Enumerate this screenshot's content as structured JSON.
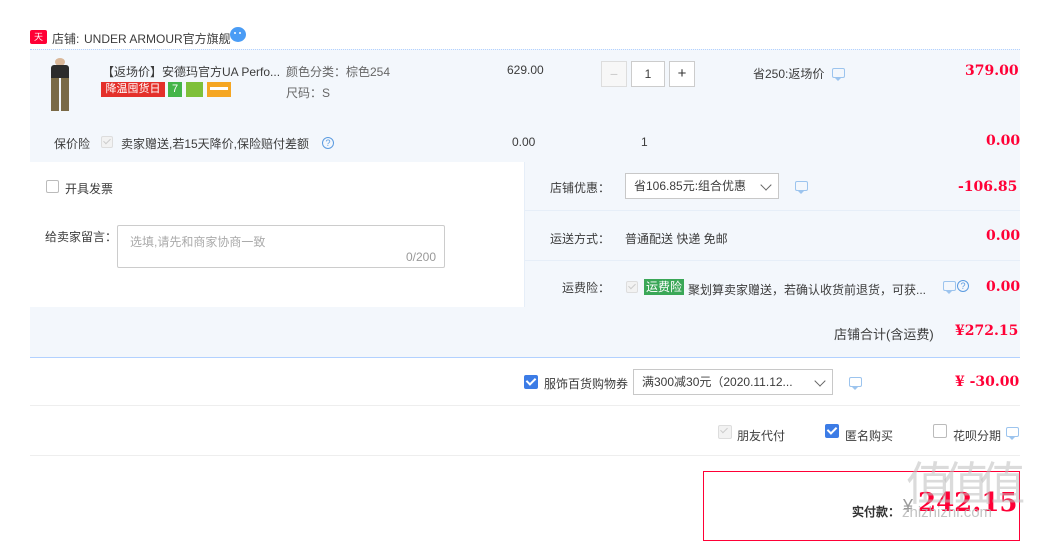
{
  "shop": {
    "label": "店铺:",
    "name": "UNDER ARMOUR官方旗舰",
    "tmall_badge": "天猫",
    "chat_icon": "wangwang-icon"
  },
  "item": {
    "title": "【返场价】安德玛官方UA Perfo...",
    "promo_badge": "降温囤货日",
    "icon_seven": "7",
    "color_label": "颜色分类：棕色254",
    "size_label": "尺码：S",
    "unit_price": "629.00",
    "quantity": "1",
    "minus": "−",
    "plus": "+",
    "discount_note": "省250:返场价",
    "subtotal": "379.00"
  },
  "insurance": {
    "label": "保价险",
    "desc": "卖家赠送,若15天降价,保险赔付差额",
    "price": "0.00",
    "qty": "1",
    "subtotal": "0.00"
  },
  "invoice": {
    "label": "开具发票"
  },
  "message": {
    "label": "给卖家留言：",
    "placeholder": "选填,请先和商家协商一致",
    "counter": "0/200"
  },
  "shop_discount": {
    "label": "店铺优惠：",
    "selected": "省106.85元:组合优惠",
    "amount": "-106.85"
  },
  "shipping": {
    "label": "运送方式：",
    "value": "普通配送 快递 免邮",
    "amount": "0.00"
  },
  "freight_insurance": {
    "label": "运费险：",
    "tag": "运费险",
    "desc": "聚划算卖家赠送，若确认收货前退货，可获...",
    "amount": "0.00"
  },
  "shop_total": {
    "label": "店铺合计(含运费)",
    "amount": "¥272.15"
  },
  "coupon": {
    "label": "服饰百货购物券",
    "selected": "满300减30元（2020.11.12...",
    "amount": "¥ -30.00"
  },
  "options": {
    "friend_pay": "朋友代付",
    "anonymous": "匿名购买",
    "huabei": "花呗分期"
  },
  "pay": {
    "label": "实付款：",
    "currency": "¥",
    "amount": "242.15"
  },
  "watermark": "值 值 值",
  "watermark_url": "zhizhizhi.com",
  "colors": {
    "accent_red": "#ff0036",
    "panel_bg": "#f3f7fc",
    "check_blue": "#3c7ce6",
    "divider": "#b2d1ff"
  }
}
